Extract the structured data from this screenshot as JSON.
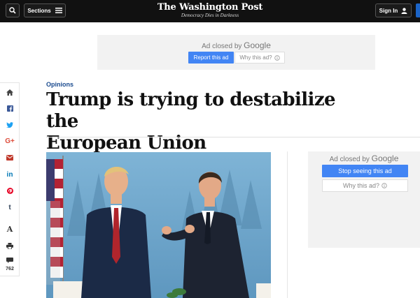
{
  "header": {
    "sections_label": "Sections",
    "brand_name": "The Washington Post",
    "brand_tagline": "Democracy Dies in Darkness",
    "signin_label": "Sign In"
  },
  "ads": {
    "top": {
      "closed_text": "Ad closed by",
      "google_text": "Google",
      "report_label": "Report this ad",
      "why_label": "Why this ad?"
    },
    "right": {
      "closed_text": "Ad closed by",
      "google_text": "Google",
      "stop_label": "Stop seeing this ad",
      "why_label": "Why this ad?"
    }
  },
  "share_rail": {
    "icons": [
      "home-icon",
      "facebook-icon",
      "twitter-icon",
      "google-plus-icon",
      "email-icon",
      "linkedin-icon",
      "pinterest-icon",
      "tumblr-icon",
      "text-size-icon",
      "print-icon",
      "comments-icon"
    ],
    "letters": {
      "gplus": "G+",
      "linkedin": "in",
      "tumblr": "t",
      "text_size": "A"
    },
    "comments_count": "762"
  },
  "article": {
    "kicker": "Opinions",
    "headline_line1": "Trump is trying to destabilize the",
    "headline_line2": "European Union"
  },
  "colors": {
    "topbar": "#111111",
    "accent_blue": "#1b64c8",
    "google_blue": "#4285f4",
    "kicker": "#1b4b8f"
  }
}
